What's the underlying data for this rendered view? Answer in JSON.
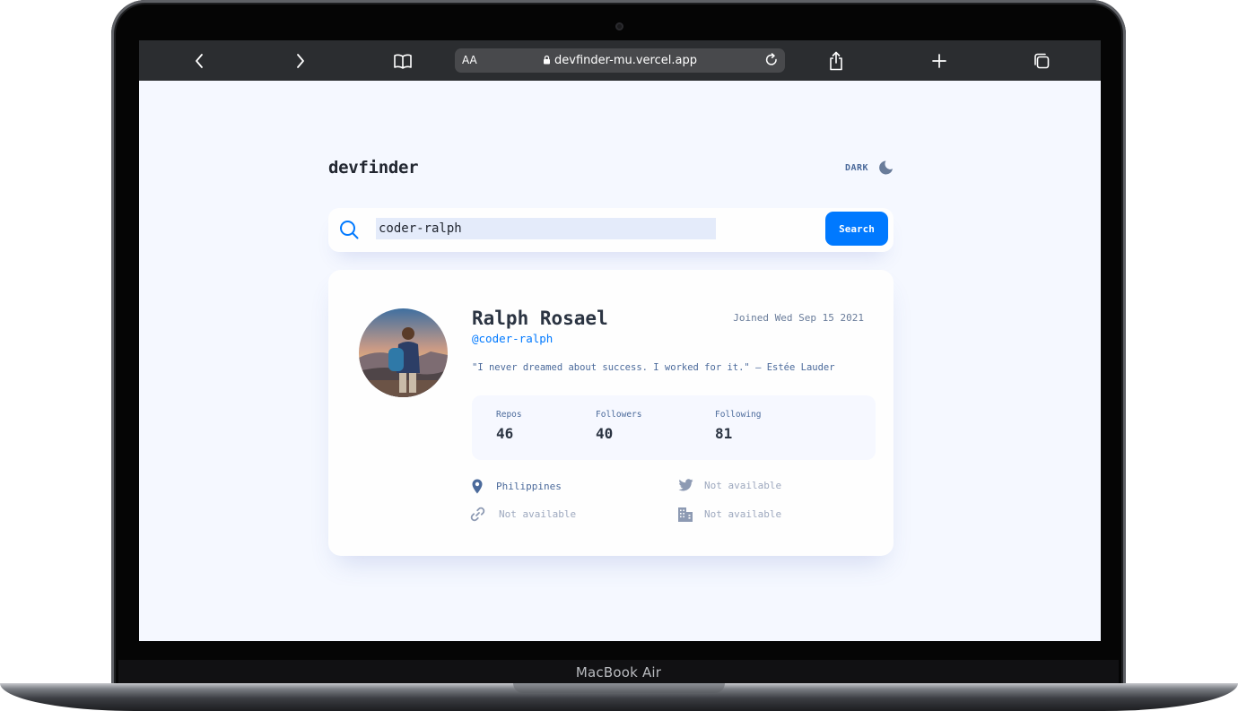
{
  "device": {
    "brand_label": "MacBook Air"
  },
  "browser": {
    "text_size_label": "AA",
    "url": "devfinder-mu.vercel.app"
  },
  "app": {
    "title": "devfinder",
    "theme_toggle_label": "DARK",
    "search": {
      "value": "coder-ralph",
      "button_label": "Search"
    },
    "profile": {
      "name": "Ralph Rosael",
      "login": "@coder-ralph",
      "joined": "Joined Wed Sep 15 2021",
      "bio": "\"I never dreamed about success. I worked for it.\" — Estée Lauder",
      "stats": {
        "repos_label": "Repos",
        "repos": "46",
        "followers_label": "Followers",
        "followers": "40",
        "following_label": "Following",
        "following": "81"
      },
      "location": "Philippines",
      "twitter": "Not available",
      "blog": "Not available",
      "company": "Not available"
    }
  },
  "colors": {
    "accent": "#0079ff",
    "page_bg": "#f5f8ff",
    "card_bg": "#fefefe",
    "heading": "#2b3442",
    "body_text": "#4b6a9b"
  },
  "icons": [
    "chevron-left-icon",
    "chevron-right-icon",
    "book-icon",
    "lock-icon",
    "reload-icon",
    "share-icon",
    "plus-icon",
    "tabs-icon",
    "moon-icon",
    "search-icon",
    "location-icon",
    "twitter-icon",
    "link-icon",
    "company-icon"
  ]
}
